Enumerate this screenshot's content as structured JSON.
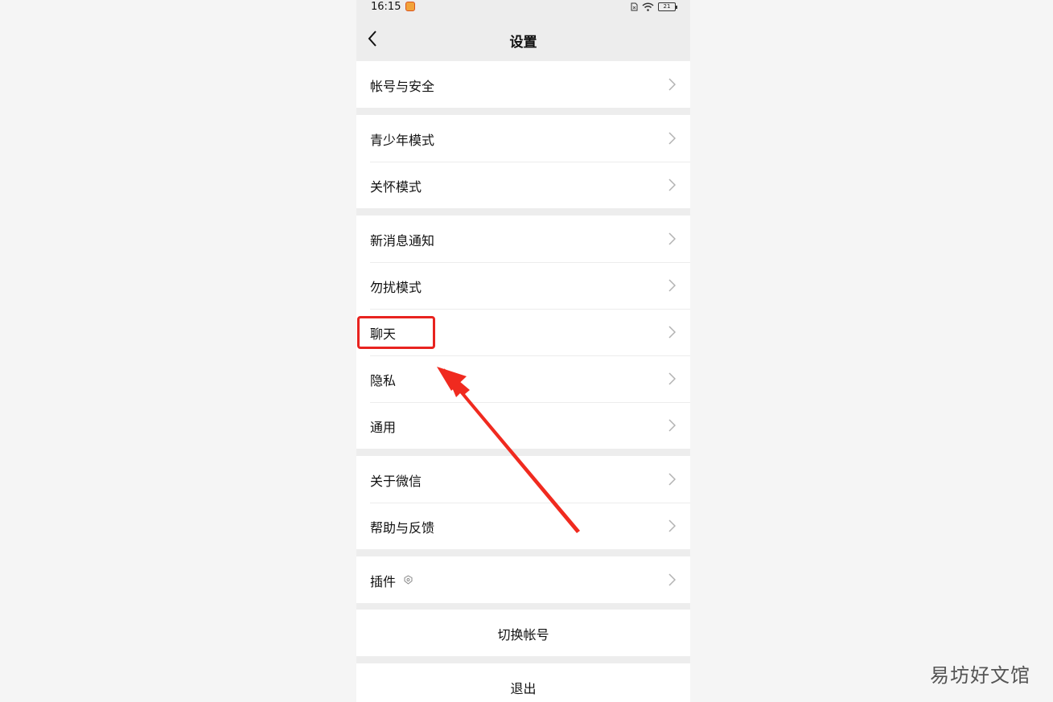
{
  "status_bar": {
    "time": "16:15",
    "battery": "21"
  },
  "nav": {
    "title": "设置"
  },
  "sections": {
    "account": [
      {
        "label": "帐号与安全"
      }
    ],
    "modes": [
      {
        "label": "青少年模式"
      },
      {
        "label": "关怀模式"
      }
    ],
    "settings": [
      {
        "label": "新消息通知"
      },
      {
        "label": "勿扰模式"
      },
      {
        "label": "聊天"
      },
      {
        "label": "隐私"
      },
      {
        "label": "通用"
      }
    ],
    "about": [
      {
        "label": "关于微信"
      },
      {
        "label": "帮助与反馈"
      }
    ],
    "plugins": [
      {
        "label": "插件"
      }
    ]
  },
  "actions": {
    "switch_account": "切换帐号",
    "logout": "退出"
  },
  "annotation": {
    "highlight_color": "#e8231f"
  },
  "watermark": "易坊好文馆",
  "icons": [
    "back-icon",
    "chevron-right-icon",
    "wifi-icon",
    "sim-icon",
    "battery-icon",
    "plugin-badge-icon"
  ]
}
